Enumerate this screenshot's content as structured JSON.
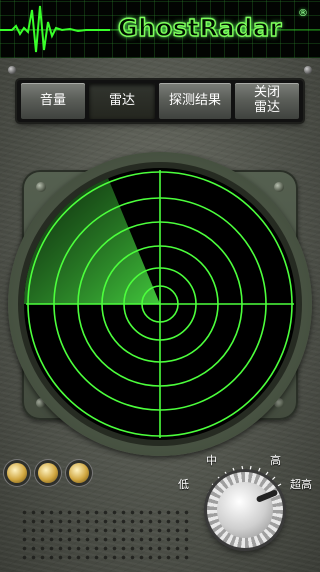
{
  "header": {
    "logo_text": "GhostRadar",
    "registered_mark": "®"
  },
  "tabs": [
    {
      "label": "音量",
      "active": false
    },
    {
      "label": "雷达",
      "active": true
    },
    {
      "label": "探测结果",
      "active": false
    },
    {
      "label": "关闭雷达",
      "active": false
    }
  ],
  "radar": {
    "grid_color": "#4cff3c",
    "screen_color": "#000000",
    "sweep_color": "#3fbf3a"
  },
  "status_lights": [
    "light-1",
    "light-2",
    "light-3"
  ],
  "sensitivity_knob": {
    "labels": {
      "low": "低",
      "mid": "中",
      "high": "高",
      "very_high": "超高"
    },
    "selected": "超高"
  }
}
